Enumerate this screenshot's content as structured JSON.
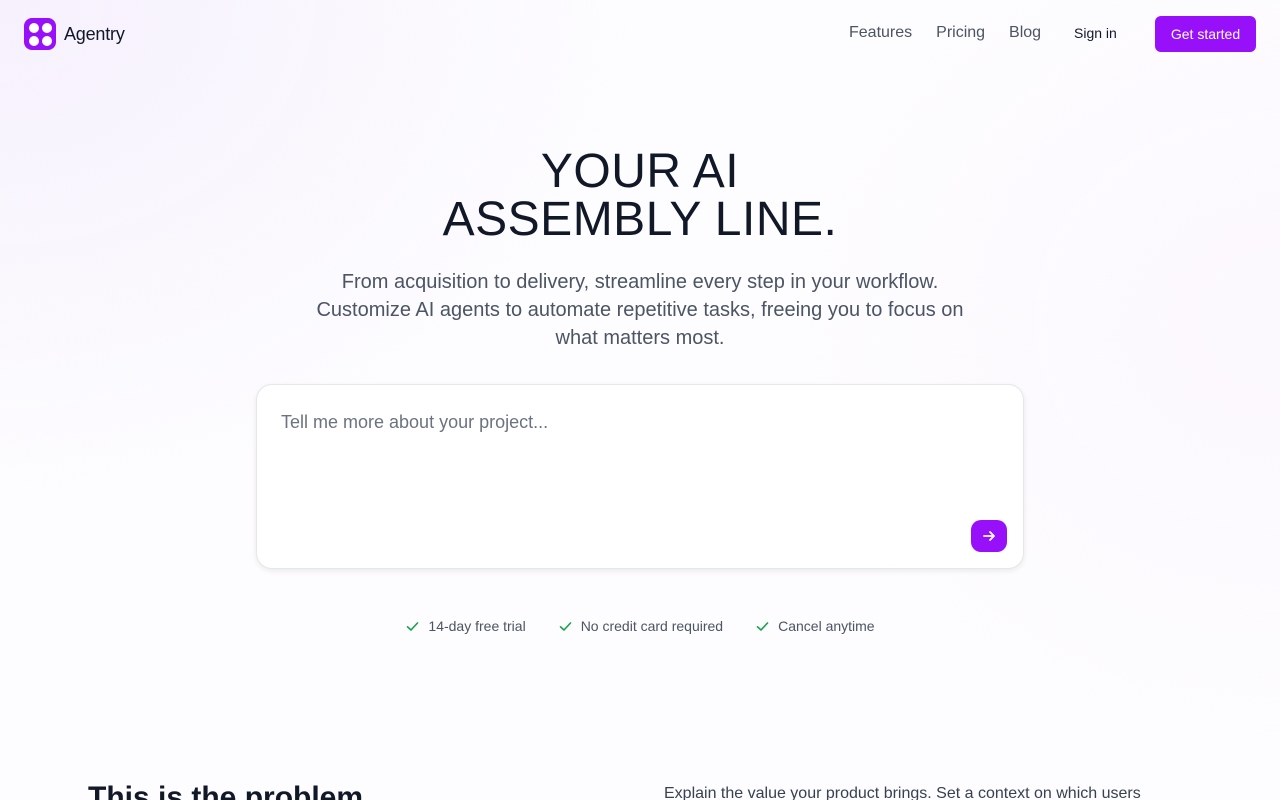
{
  "brand": {
    "name": "Agentry",
    "logo_icon": "four-dots-icon",
    "accent": "#9810fa"
  },
  "nav": {
    "items": [
      {
        "label": "Features"
      },
      {
        "label": "Pricing"
      },
      {
        "label": "Blog"
      }
    ],
    "sign_in": "Sign in",
    "cta": "Get started"
  },
  "hero": {
    "title_line1": "YOUR AI",
    "title_line2": "ASSEMBLY LINE.",
    "subtitle": "From acquisition to delivery, streamline every step in your workflow. Customize AI agents to automate repetitive tasks, freeing you to focus on what matters most."
  },
  "prompt": {
    "placeholder": "Tell me more about your project...",
    "value": "",
    "send_icon": "arrow-right-icon"
  },
  "perks": [
    {
      "label": "14-day free trial",
      "icon": "check-icon"
    },
    {
      "label": "No credit card required",
      "icon": "check-icon"
    },
    {
      "label": "Cancel anytime",
      "icon": "check-icon"
    }
  ],
  "colors": {
    "check": "#16a34a"
  },
  "problem": {
    "heading": "This is the problem",
    "text": "Explain the value your product brings. Set a context on which users"
  }
}
